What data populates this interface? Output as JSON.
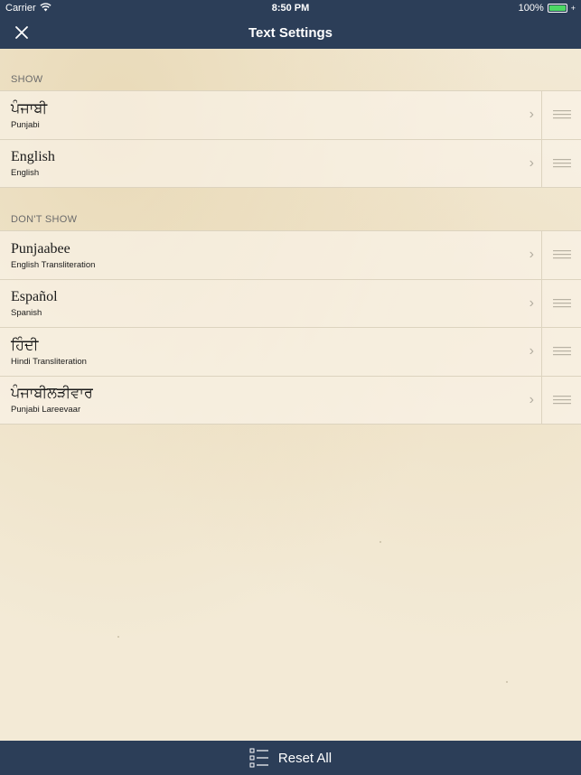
{
  "status_bar": {
    "carrier": "Carrier",
    "time": "8:50 PM",
    "battery": "100%",
    "battery_level": 1.0,
    "wifi_icon": "wifi-icon",
    "battery_icon": "battery-icon"
  },
  "nav": {
    "title": "Text Settings",
    "close_icon": "close-icon"
  },
  "sections": {
    "show": {
      "header": "SHOW",
      "items": [
        {
          "title": "ਪੰਜਾਬੀ",
          "subtitle": "Punjabi"
        },
        {
          "title": "English",
          "subtitle": "English"
        }
      ]
    },
    "dont_show": {
      "header": "DON'T SHOW",
      "items": [
        {
          "title": "Punjaabee",
          "subtitle": "English Transliteration"
        },
        {
          "title": "Español",
          "subtitle": "Spanish"
        },
        {
          "title": "ਹਿੰਦੀ",
          "subtitle": "Hindi Transliteration"
        },
        {
          "title": "ਪੰਜਾਬੀਲੜੀਵਾਰ",
          "subtitle": "Punjabi Lareevaar"
        }
      ]
    }
  },
  "footer": {
    "reset_label": "Reset All",
    "icon": "checklist-icon"
  },
  "colors": {
    "bar": "#2c3e58",
    "background": "#f3ead6",
    "battery_green": "#4cd964"
  }
}
